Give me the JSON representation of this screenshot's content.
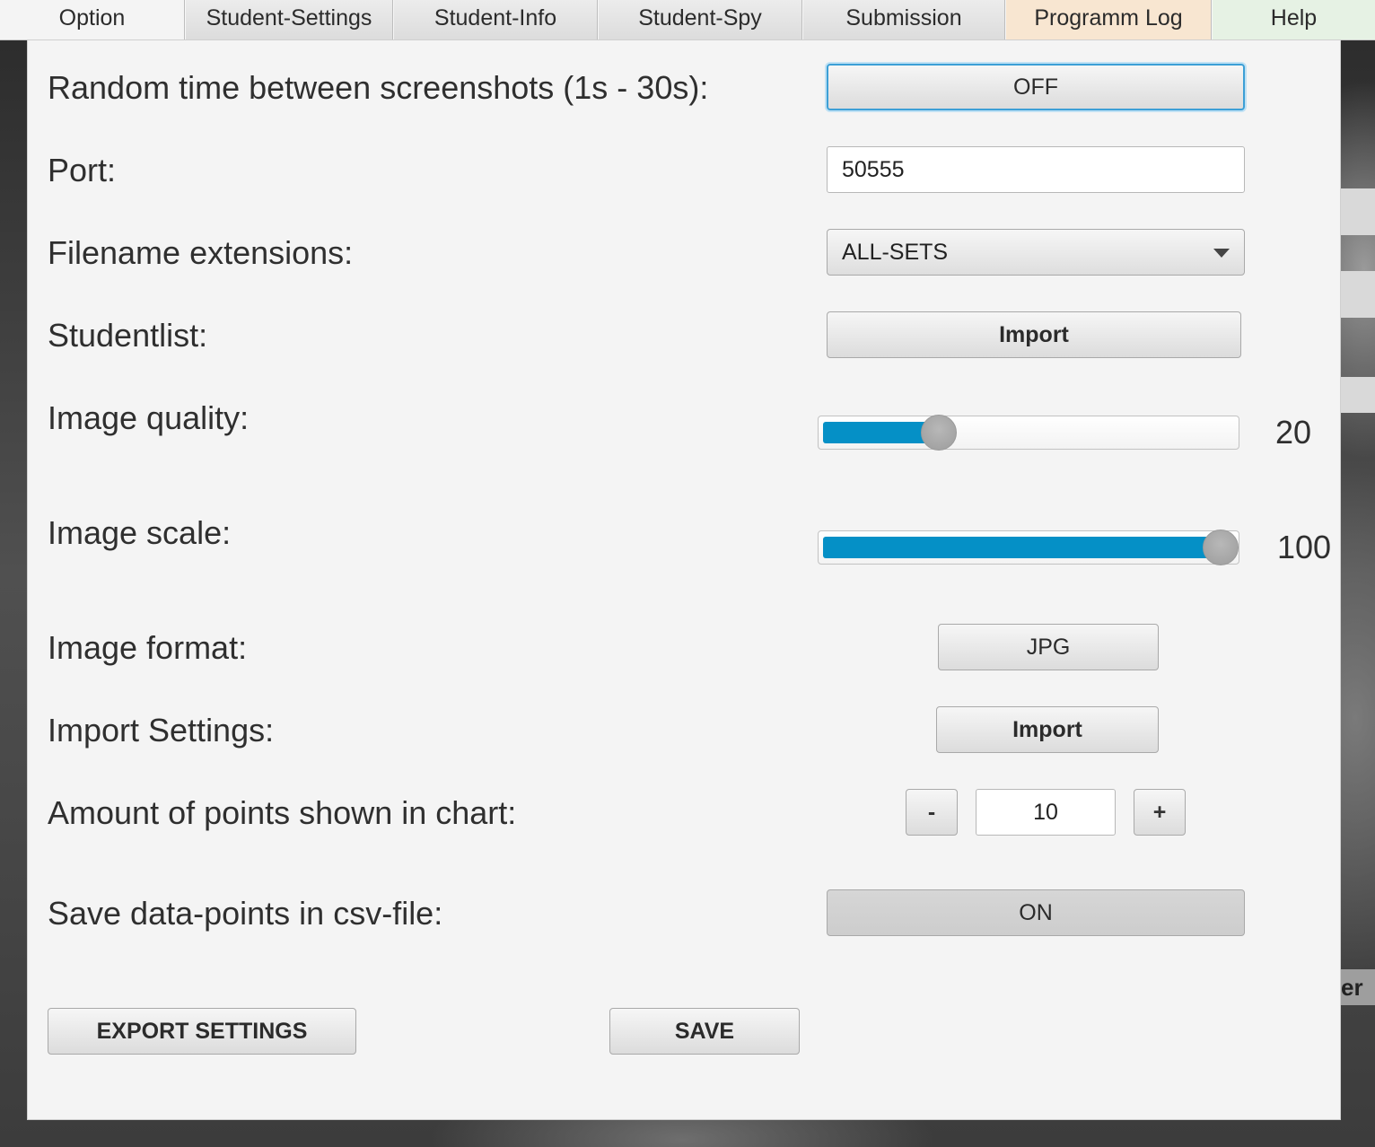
{
  "tabs": [
    {
      "label": "Option"
    },
    {
      "label": "Student-Settings"
    },
    {
      "label": "Student-Info"
    },
    {
      "label": "Student-Spy"
    },
    {
      "label": "Submission"
    },
    {
      "label": "Programm Log"
    },
    {
      "label": "Help"
    }
  ],
  "settings": {
    "random_time": {
      "label": "Random time between screenshots (1s - 30s):",
      "toggle": "OFF"
    },
    "port": {
      "label": "Port:",
      "value": "50555"
    },
    "filename_extensions": {
      "label": "Filename extensions:",
      "selected": "ALL-SETS"
    },
    "studentlist": {
      "label": "Studentlist:",
      "button": "Import"
    },
    "image_quality": {
      "label": "Image quality:",
      "value": "20",
      "level": 20,
      "max": 100
    },
    "image_scale": {
      "label": "Image scale:",
      "value": "100",
      "level": 100,
      "max": 100
    },
    "image_format": {
      "label": "Image format:",
      "button": "JPG"
    },
    "import_settings": {
      "label": "Import Settings:",
      "button": "Import"
    },
    "chart_points": {
      "label": "Amount of points shown in chart:",
      "decrement": "-",
      "value": "10",
      "increment": "+"
    },
    "save_csv": {
      "label": "Save data-points in csv-file:",
      "toggle": "ON"
    }
  },
  "footer": {
    "export": "EXPORT SETTINGS",
    "save": "SAVE"
  },
  "background_window": {
    "text": "er"
  },
  "colors": {
    "accent": "#0590c6",
    "focus": "#3c9fd6",
    "log_tab": "#f8e6d1",
    "help_tab": "#e6f2e4"
  }
}
